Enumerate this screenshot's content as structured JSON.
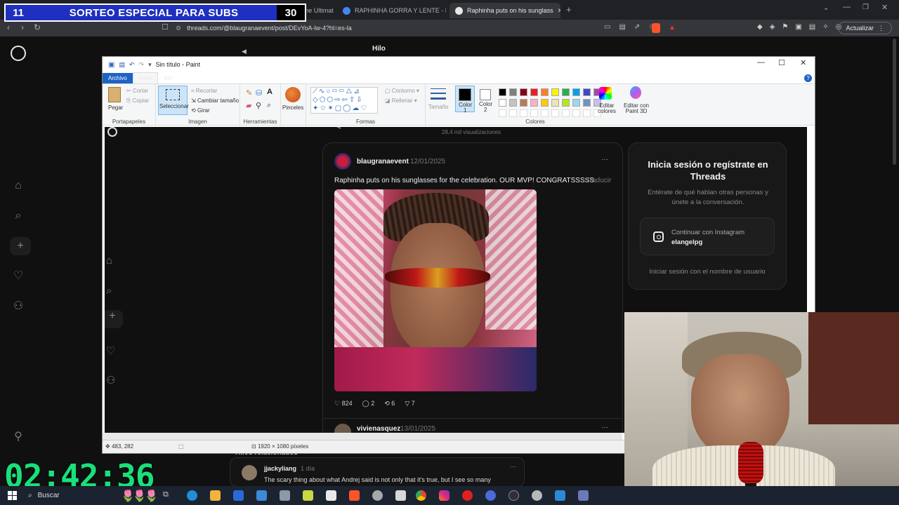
{
  "banner": {
    "left_number": "11",
    "text": "SORTEO ESPECIAL PARA SUBS",
    "right_number": "30"
  },
  "browser": {
    "tabs": [
      {
        "label": "StreamElements | The Ultimate Stre"
      },
      {
        "label": "RAPHINHA GORRA Y LENTE - Busca"
      },
      {
        "label": "Raphinha puts on his sunglass"
      }
    ],
    "url": "threads.com/@blaugranaevent/post/DEvYoA-lw-4?hl=es-la",
    "update_button": "Actualizar"
  },
  "threads_header": {
    "title": "Hilo",
    "views_behind": "28,4 mil visualizaciones"
  },
  "paint": {
    "title": "Sin título - Paint",
    "tabs": {
      "file": "Archivo",
      "home": "Inicio",
      "view": "Ver"
    },
    "clipboard": {
      "paste": "Pegar",
      "cut": "Cortar",
      "copy": "Copiar",
      "group": "Portapapeles"
    },
    "image": {
      "select": "Seleccionar",
      "crop": "Recortar",
      "resize": "Cambiar tamaño",
      "rotate": "Girar",
      "group": "Imagen"
    },
    "tools": {
      "group": "Herramientas"
    },
    "brushes": {
      "label": "Pinceles"
    },
    "shapes": {
      "outline": "Contorno",
      "fill": "Rellenar",
      "group": "Formas"
    },
    "size": {
      "label": "Tamaño"
    },
    "colors": {
      "color1": "Color",
      "color1_num": "1",
      "color2": "Color",
      "color2_num": "2",
      "edit": "Editar colores",
      "paint3d": "Editar con Paint 3D",
      "group": "Colores"
    },
    "status": {
      "cursor": "483, 282",
      "dimensions": "1920 × 1080 píxeles"
    },
    "palette": [
      "#000000",
      "#7f7f7f",
      "#880015",
      "#ed1c24",
      "#ff7f27",
      "#fff200",
      "#22b14c",
      "#00a2e8",
      "#3f48cc",
      "#a349a4",
      "#ffffff",
      "#c3c3c3",
      "#b97a57",
      "#ffaec9",
      "#ffc90e",
      "#efe4b0",
      "#b5e61d",
      "#99d9ea",
      "#7092be",
      "#c8bfe7"
    ]
  },
  "post": {
    "views": "28,4 mil visualizaciones",
    "username": "blaugranaevent",
    "date": "12/01/2025",
    "text": "Raphinha puts on his sunglasses for the celebration. OUR MVP! CONGRATSSSSS",
    "translate": "Traducir",
    "likes": "824",
    "comments": "2",
    "reposts": "6",
    "shares": "7",
    "next_username": "vivienasquez",
    "next_date": "13/01/2025"
  },
  "login_card": {
    "title": "Inicia sesión o regístrate en Threads",
    "subtitle": "Entérate de qué hablan otras personas y únete a la conversación.",
    "instagram_label": "Continuar con Instagram",
    "instagram_user": "elangelpg",
    "username_login": "Iniciar sesión con el nombre de usuario"
  },
  "related": {
    "heading": "Hilos relacionados",
    "username": "jjackyliang",
    "time": "1 día",
    "text": "The scary thing about what Andrej said is not only that it's true, but I see so many"
  },
  "timer": "02:42:36",
  "taskbar": {
    "search": "Buscar"
  }
}
